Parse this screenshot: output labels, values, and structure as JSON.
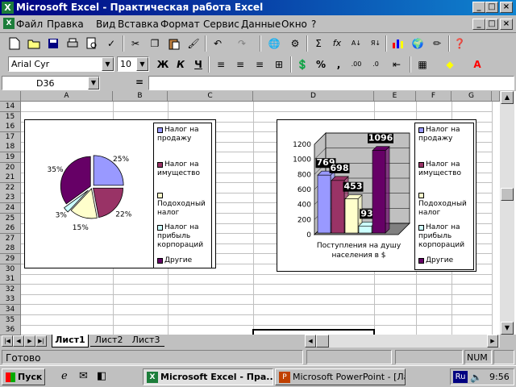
{
  "window": {
    "title": "Microsoft Excel - Практическая работа Excel"
  },
  "menu": [
    "Файл",
    "Правка",
    "Вид",
    "Вставка",
    "Формат",
    "Сервис",
    "Данные",
    "Окно",
    "?"
  ],
  "formatting": {
    "font": "Arial Cyr",
    "size": "10",
    "bold": "Ж",
    "italic": "К",
    "underline": "Ч",
    "percent": "%",
    "comma": ","
  },
  "toolbar": {
    "sum": "Σ",
    "fx": "fx"
  },
  "formula_bar": {
    "name_box": "D36",
    "equals": "="
  },
  "columns": [
    "A",
    "B",
    "C",
    "D",
    "E",
    "F",
    "G"
  ],
  "rows": [
    "14",
    "15",
    "16",
    "17",
    "18",
    "19",
    "20",
    "21",
    "22",
    "23",
    "24",
    "25",
    "26",
    "27",
    "28",
    "29",
    "30",
    "31",
    "32",
    "33",
    "34",
    "35",
    "36"
  ],
  "colors": {
    "s1": "#9999ff",
    "s2": "#993366",
    "s3": "#ffffcc",
    "s4": "#ccffff",
    "s5": "#660066"
  },
  "legend": [
    "Налог на продажу",
    "Налог на имущество",
    "Подоходный налог",
    "Налог на прибыль корпораций",
    "Другие"
  ],
  "chart_data": [
    {
      "type": "pie",
      "categories": [
        "Налог на продажу",
        "Налог на имущество",
        "Подоходный налог",
        "Налог на прибыль корпораций",
        "Другие"
      ],
      "values": [
        25,
        22,
        15,
        3,
        35
      ],
      "data_labels": [
        "25%",
        "22%",
        "15%",
        "3%",
        "35%"
      ],
      "legend_placement": "right"
    },
    {
      "type": "bar",
      "categories": [
        "Поступления на душу населения в $"
      ],
      "xlabel": "Поступления на душу населения в $",
      "series": [
        {
          "name": "Налог на продажу",
          "values": [
            769
          ]
        },
        {
          "name": "Налог на имущество",
          "values": [
            698
          ]
        },
        {
          "name": "Подоходный налог",
          "values": [
            453
          ]
        },
        {
          "name": "Налог на прибыль корпораций",
          "values": [
            93
          ]
        },
        {
          "name": "Другие",
          "values": [
            1096
          ]
        }
      ],
      "ylim": [
        0,
        1200
      ],
      "yticks": [
        "0",
        "200",
        "400",
        "600",
        "800",
        "1000",
        "1200"
      ],
      "legend_placement": "right",
      "grid": true
    }
  ],
  "sheet_tabs": [
    "Лист1",
    "Лист2",
    "Лист3"
  ],
  "status": {
    "ready": "Готово",
    "num": "NUM"
  },
  "taskbar": {
    "start": "Пуск",
    "task1": "Microsoft Excel - Пра...",
    "task2": "Microsoft PowerPoint - [Ла...",
    "lang": "Ru",
    "clock": "9:56"
  }
}
